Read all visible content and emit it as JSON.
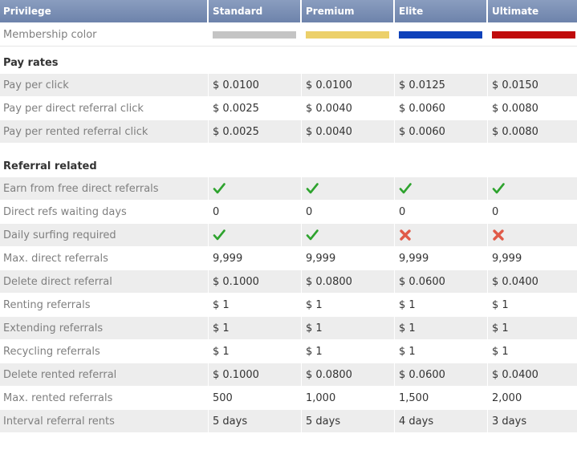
{
  "header": {
    "privilege": "Privilege",
    "tiers": [
      "Standard",
      "Premium",
      "Elite",
      "Ultimate"
    ]
  },
  "membership_color": {
    "label": "Membership color",
    "colors": [
      "#c4c4c4",
      "#ecd06a",
      "#0e41ba",
      "#c00b0b"
    ]
  },
  "pay_rates": {
    "title": "Pay rates",
    "rows": [
      {
        "label": "Pay per click",
        "values": [
          "$ 0.0100",
          "$ 0.0100",
          "$ 0.0125",
          "$ 0.0150"
        ]
      },
      {
        "label": "Pay per direct referral click",
        "values": [
          "$ 0.0025",
          "$ 0.0040",
          "$ 0.0060",
          "$ 0.0080"
        ]
      },
      {
        "label": "Pay per rented referral click",
        "values": [
          "$ 0.0025",
          "$ 0.0040",
          "$ 0.0060",
          "$ 0.0080"
        ]
      }
    ]
  },
  "referral_related": {
    "title": "Referral related",
    "rows": [
      {
        "label": "Earn from free direct referrals",
        "values": [
          "check-icon",
          "check-icon",
          "check-icon",
          "check-icon"
        ]
      },
      {
        "label": "Direct refs waiting days",
        "values": [
          "0",
          "0",
          "0",
          "0"
        ]
      },
      {
        "label": "Daily surfing required",
        "values": [
          "check-icon",
          "check-icon",
          "cross-icon",
          "cross-icon"
        ]
      },
      {
        "label": "Max. direct referrals",
        "values": [
          "9,999",
          "9,999",
          "9,999",
          "9,999"
        ]
      },
      {
        "label": "Delete direct referral",
        "values": [
          "$ 0.1000",
          "$ 0.0800",
          "$ 0.0600",
          "$ 0.0400"
        ]
      },
      {
        "label": "Renting referrals",
        "values": [
          "$ 1",
          "$ 1",
          "$ 1",
          "$ 1"
        ]
      },
      {
        "label": "Extending referrals",
        "values": [
          "$ 1",
          "$ 1",
          "$ 1",
          "$ 1"
        ]
      },
      {
        "label": "Recycling referrals",
        "values": [
          "$ 1",
          "$ 1",
          "$ 1",
          "$ 1"
        ]
      },
      {
        "label": "Delete rented referral",
        "values": [
          "$ 0.1000",
          "$ 0.0800",
          "$ 0.0600",
          "$ 0.0400"
        ]
      },
      {
        "label": "Max. rented referrals",
        "values": [
          "500",
          "1,000",
          "1,500",
          "2,000"
        ]
      },
      {
        "label": "Interval referral rents",
        "values": [
          "5 days",
          "5 days",
          "4 days",
          "3 days"
        ]
      }
    ]
  }
}
